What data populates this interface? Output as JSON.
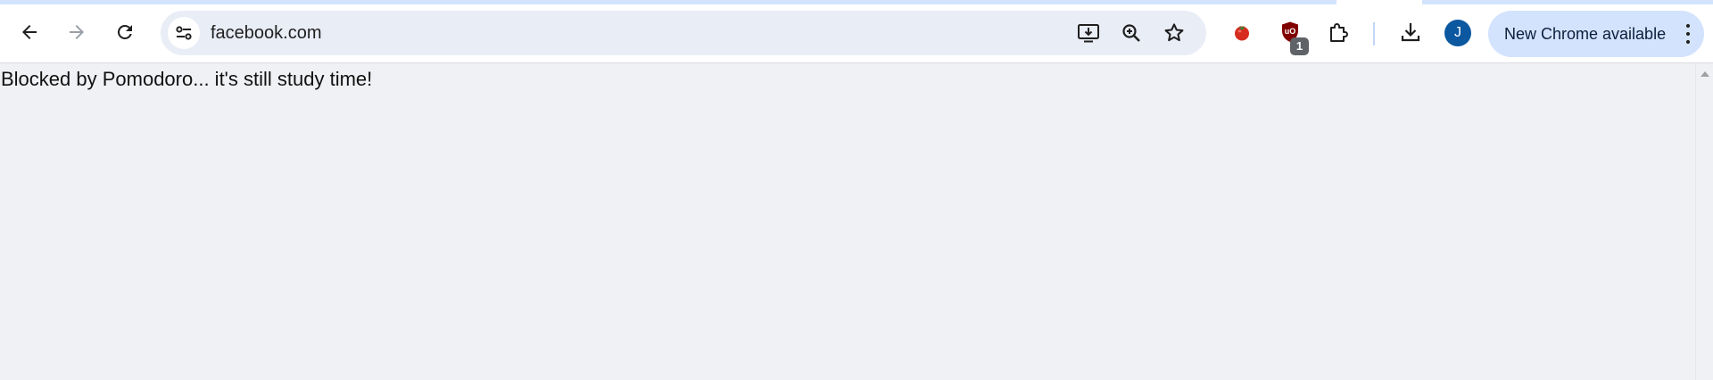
{
  "browser": {
    "address_bar": {
      "url": "facebook.com"
    },
    "extensions": {
      "tomato_icon": "tomato-icon",
      "ublock_badge_count": "1"
    },
    "profile": {
      "initial": "J"
    },
    "update_button": {
      "label": "New Chrome available"
    },
    "colors": {
      "toolbar_bg": "#ffffff",
      "omnibox_bg": "#e9edf6",
      "update_pill_bg": "#d3e3fd",
      "avatar_bg": "#0b57a0",
      "ublock_red": "#800000",
      "page_bg": "#f0f1f4"
    }
  },
  "page": {
    "message": "Blocked by Pomodoro... it's still study time!"
  }
}
